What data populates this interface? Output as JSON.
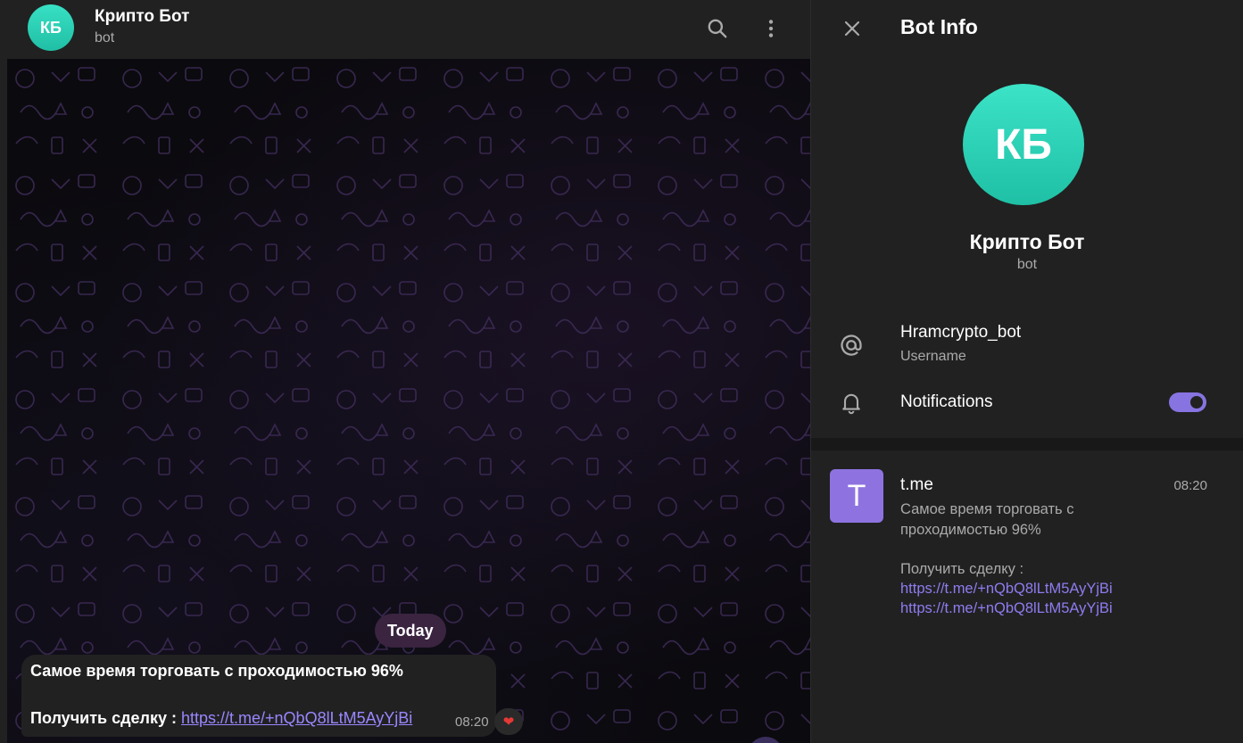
{
  "chat": {
    "avatar_initials": "КБ",
    "title": "Крипто Бот",
    "subtitle": "bot",
    "date_separator": "Today",
    "message": {
      "line1": "Самое время торговать с проходимостью 96%",
      "line2_prefix": "Получить сделку : ",
      "link": "https://t.me/+nQbQ8lLtM5AyYjBi",
      "time": "08:20",
      "reaction": "❤"
    }
  },
  "info": {
    "title": "Bot Info",
    "avatar_initials": "КБ",
    "name": "Крипто Бот",
    "subtitle": "bot",
    "username": "Hramcrypto_bot",
    "username_label": "Username",
    "notifications_label": "Notifications",
    "notifications_on": true,
    "link_card": {
      "thumb_letter": "T",
      "title": "t.me",
      "time": "08:20",
      "desc_line1": "Самое время торговать с",
      "desc_line2": "проходимостью 96%",
      "desc_line3": "Получить сделку :",
      "url1": "https://t.me/+nQbQ8lLtM5AyYjBi",
      "url2": "https://t.me/+nQbQ8lLtM5AyYjBi"
    }
  },
  "icons": [
    "search-icon",
    "more-vertical-icon",
    "close-icon",
    "at-icon",
    "bell-icon"
  ],
  "colors": {
    "accent": "#8774e1",
    "avatar": "#2fd3b7",
    "link": "#9b86ff",
    "panel": "#212121"
  }
}
